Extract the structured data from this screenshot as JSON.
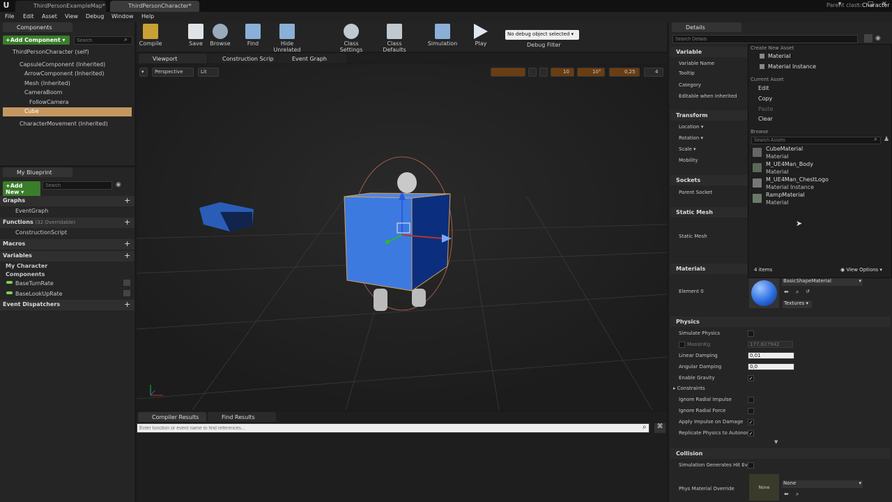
{
  "titlebar": {
    "tabs": [
      "ThirdPersonExampleMap*",
      "ThirdPersonCharacter*"
    ],
    "parent_class_label": "Parent class:",
    "parent_class_value": "Character"
  },
  "menu": [
    "File",
    "Edit",
    "Asset",
    "View",
    "Debug",
    "Window",
    "Help"
  ],
  "components": {
    "tab": "Components",
    "add_button": "+Add Component ▾",
    "search_placeholder": "Search",
    "self_label": "ThirdPersonCharacter (self)",
    "tree": [
      "CapsuleComponent (Inherited)",
      "ArrowComponent (Inherited)",
      "Mesh (Inherited)",
      "CameraBoom",
      "FollowCamera",
      "Cube",
      "CharacterMovement (Inherited)"
    ]
  },
  "myblueprint": {
    "tab": "My Blueprint",
    "add_button": "+Add New ▾",
    "search_placeholder": "Search",
    "graphs": "Graphs",
    "event_graph": "EventGraph",
    "functions": "Functions",
    "functions_note": "(32 Overridable)",
    "construction_script": "ConstructionScript",
    "macros": "Macros",
    "variables": "Variables",
    "my_character": "My Character",
    "components": "Components",
    "base_turn_rate": "BaseTurnRate",
    "base_lookup_rate": "BaseLookUpRate",
    "event_dispatchers": "Event Dispatchers"
  },
  "toolbar": {
    "compile": "Compile",
    "save": "Save",
    "browse": "Browse",
    "find": "Find",
    "hide_unrelated": "Hide Unrelated",
    "class_settings": "Class Settings",
    "class_defaults": "Class Defaults",
    "simulation": "Simulation",
    "play": "Play",
    "debug_dropdown": "No debug object selected ▾",
    "debug_filter": "Debug Filter"
  },
  "editor_tabs": [
    "Viewport",
    "Construction Scrip",
    "Event Graph"
  ],
  "viewport": {
    "perspective": "Perspective",
    "lit": "Lit",
    "grid_snap": "10",
    "rot_snap": "10°",
    "scale_snap": "0,25",
    "camera_speed": "4"
  },
  "bottom": {
    "tabs": [
      "Compiler Results",
      "Find Results"
    ],
    "search_placeholder": "Enter function or event name to find references..."
  },
  "details": {
    "tab": "Details",
    "search_placeholder": "Search Details",
    "variable": "Variable",
    "variable_name": "Variable Name",
    "tooltip": "Tooltip",
    "category": "Category",
    "editable_when_inherited": "Editable when Inherited",
    "transform": "Transform",
    "location": "Location ▾",
    "rotation": "Rotation ▾",
    "scale": "Scale ▾",
    "mobility": "Mobility",
    "sockets": "Sockets",
    "parent_socket": "Parent Socket",
    "static_mesh_sec": "Static Mesh",
    "static_mesh": "Static Mesh",
    "materials": "Materials",
    "element0": "Element 0",
    "material_value": "BasicShapeMaterial",
    "textures": "Textures ▾",
    "physics": "Physics",
    "simulate_physics": "Simulate Physics",
    "mass_in_kg": "MassInKg",
    "mass_value": "177,827942",
    "linear_damping": "Linear Damping",
    "linear_damping_value": "0,01",
    "angular_damping": "Angular Damping",
    "angular_damping_value": "0,0",
    "enable_gravity": "Enable Gravity",
    "constraints": "Constraints",
    "ignore_radial_impulse": "Ignore Radial Impulse",
    "ignore_radial_force": "Ignore Radial Force",
    "apply_impulse_on_damage": "Apply Impulse on Damage",
    "replicate_physics": "Replicate Physics to Autonor",
    "collision": "Collision",
    "sim_generates_hit": "Simulation Generates Hit Eve",
    "phys_material_override": "Phys Material Override",
    "phys_none_thumb": "None",
    "phys_none_value": "None"
  },
  "asset_picker": {
    "create_new_asset": "Create New Asset",
    "material": "Material",
    "material_instance": "Material Instance",
    "current_asset": "Current Asset",
    "edit": "Edit",
    "copy": "Copy",
    "paste": "Paste",
    "clear": "Clear",
    "browse": "Browse",
    "search_placeholder": "Search Assets",
    "assets": [
      {
        "name": "CubeMaterial",
        "type": "Material"
      },
      {
        "name": "M_UE4Man_Body",
        "type": "Material"
      },
      {
        "name": "M_UE4Man_ChestLogo",
        "type": "Material Instance"
      },
      {
        "name": "RampMaterial",
        "type": "Material"
      }
    ],
    "count": "4 items",
    "view_options": "View Options ▾"
  },
  "colors": {
    "selection": "#c49760",
    "accent_green": "#3a7d2a",
    "cube_blue": "#3d7ae0"
  }
}
